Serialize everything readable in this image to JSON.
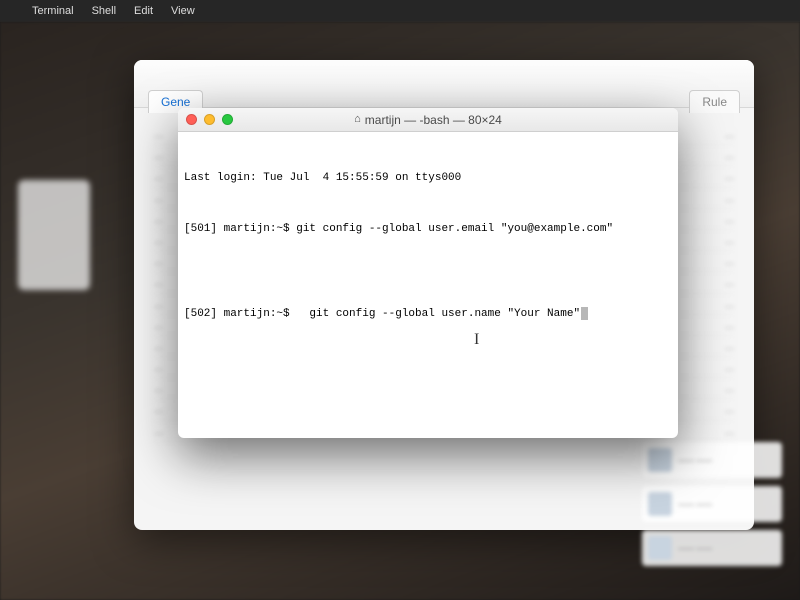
{
  "menubar": {
    "apple": "",
    "items": [
      "Terminal",
      "Shell",
      "Edit",
      "View"
    ]
  },
  "back_window": {
    "tab_left": "Gene",
    "tab_right": "Rule"
  },
  "terminal": {
    "title": "martijn — -bash — 80×24",
    "lines": {
      "l0": "Last login: Tue Jul  4 15:55:59 on ttys000",
      "l1": "[501] martijn:~$ git config --global user.email \"you@example.com\"",
      "l2": "[502] martijn:~$   git config --global user.name \"Your Name\""
    }
  },
  "ibeam_glyph": "I"
}
